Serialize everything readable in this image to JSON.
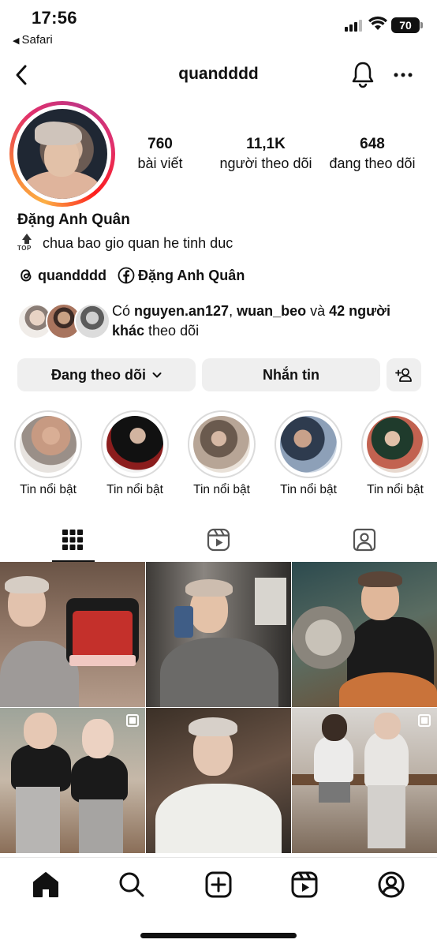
{
  "status_bar": {
    "time": "17:56",
    "back_app": "Safari",
    "battery": "70"
  },
  "header": {
    "username": "quandddd"
  },
  "profile": {
    "stats": [
      {
        "value": "760",
        "label": "bài viết"
      },
      {
        "value": "11,1K",
        "label": "người theo dõi"
      },
      {
        "value": "648",
        "label": "đang theo dõi"
      }
    ],
    "full_name": "Đặng Anh Quân",
    "bio_badge": "TOP",
    "bio": "chua bao gio quan he tinh duc",
    "threads_handle": "quandddd",
    "facebook_name": "Đặng Anh Quân",
    "followed_by": {
      "prefix": "Có ",
      "user1": "nguyen.an127",
      "sep": ", ",
      "user2": "wuan_beo",
      "and": " và ",
      "others": "42 người khác",
      "suffix": " theo dõi"
    }
  },
  "actions": {
    "following": "Đang theo dõi",
    "message": "Nhắn tin"
  },
  "highlights": [
    {
      "label": "Tin nổi bật"
    },
    {
      "label": "Tin nổi bật"
    },
    {
      "label": "Tin nổi bật"
    },
    {
      "label": "Tin nổi bật"
    },
    {
      "label": "Tin nổi bật"
    }
  ],
  "tabs": [
    "grid-icon",
    "reels-icon",
    "tagged-icon"
  ],
  "nav": [
    "home-icon",
    "search-icon",
    "create-icon",
    "reels-icon",
    "profile-icon"
  ],
  "colors": {
    "text": "#111111",
    "button_bg": "#efefef",
    "ring_start": "#fcaf45",
    "ring_end": "#c13584"
  }
}
